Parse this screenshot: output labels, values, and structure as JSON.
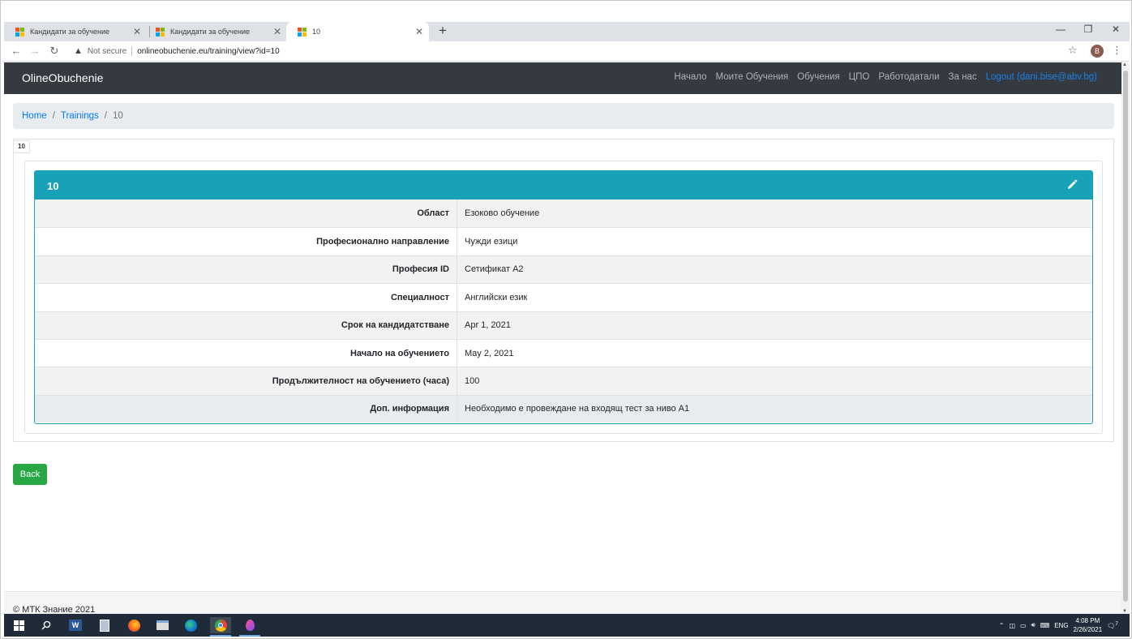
{
  "browser": {
    "tabs": [
      {
        "title": "Кандидати за обучение"
      },
      {
        "title": "Кандидати за обучение"
      },
      {
        "title": "10"
      }
    ],
    "security_label": "Not secure",
    "url": "onlineobuchenie.eu/training/view?id=10",
    "profile_initial": "B"
  },
  "navbar": {
    "brand": "OlineObuchenie",
    "links": [
      "Начало",
      "Моите Обучения",
      "Обучения",
      "ЦПО",
      "Работодатали",
      "За нас"
    ],
    "logout": "Logout (dani.bise@abv.bg)"
  },
  "breadcrumb": {
    "home": "Home",
    "trainings": "Trainings",
    "current": "10"
  },
  "panel": {
    "tag": "10",
    "title": "10",
    "rows": [
      {
        "label": "Област",
        "value": "Езоково обучение"
      },
      {
        "label": "Професионално направление",
        "value": "Чужди езици"
      },
      {
        "label": "Професия ID",
        "value": "Сетификат А2"
      },
      {
        "label": "Специалност",
        "value": "Английски език"
      },
      {
        "label": "Срок на кандидатстване",
        "value": "Apr 1, 2021"
      },
      {
        "label": "Начало на обучението",
        "value": "May 2, 2021"
      },
      {
        "label": "Продължителност на обучението (часа)",
        "value": "100"
      },
      {
        "label": "Доп. информация",
        "value": "Необходимо е провеждане на входящ тест за ниво А1"
      }
    ]
  },
  "actions": {
    "back": "Back"
  },
  "footer": {
    "text": "© МТК Знание 2021"
  },
  "taskbar": {
    "lang": "ENG",
    "time": "4:08 PM",
    "date": "2/26/2021",
    "notifications": "7"
  },
  "colors": {
    "navbar_bg": "#343a40",
    "card_header": "#17a2b8",
    "link": "#007bff",
    "back_button": "#28a745"
  }
}
